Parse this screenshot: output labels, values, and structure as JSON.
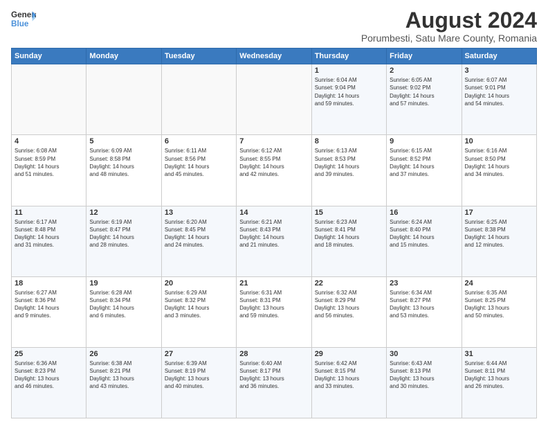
{
  "logo": {
    "line1": "General",
    "line2": "Blue"
  },
  "title": "August 2024",
  "subtitle": "Porumbesti, Satu Mare County, Romania",
  "days_of_week": [
    "Sunday",
    "Monday",
    "Tuesday",
    "Wednesday",
    "Thursday",
    "Friday",
    "Saturday"
  ],
  "weeks": [
    [
      {
        "day": "",
        "info": ""
      },
      {
        "day": "",
        "info": ""
      },
      {
        "day": "",
        "info": ""
      },
      {
        "day": "",
        "info": ""
      },
      {
        "day": "1",
        "info": "Sunrise: 6:04 AM\nSunset: 9:04 PM\nDaylight: 14 hours\nand 59 minutes."
      },
      {
        "day": "2",
        "info": "Sunrise: 6:05 AM\nSunset: 9:02 PM\nDaylight: 14 hours\nand 57 minutes."
      },
      {
        "day": "3",
        "info": "Sunrise: 6:07 AM\nSunset: 9:01 PM\nDaylight: 14 hours\nand 54 minutes."
      }
    ],
    [
      {
        "day": "4",
        "info": "Sunrise: 6:08 AM\nSunset: 8:59 PM\nDaylight: 14 hours\nand 51 minutes."
      },
      {
        "day": "5",
        "info": "Sunrise: 6:09 AM\nSunset: 8:58 PM\nDaylight: 14 hours\nand 48 minutes."
      },
      {
        "day": "6",
        "info": "Sunrise: 6:11 AM\nSunset: 8:56 PM\nDaylight: 14 hours\nand 45 minutes."
      },
      {
        "day": "7",
        "info": "Sunrise: 6:12 AM\nSunset: 8:55 PM\nDaylight: 14 hours\nand 42 minutes."
      },
      {
        "day": "8",
        "info": "Sunrise: 6:13 AM\nSunset: 8:53 PM\nDaylight: 14 hours\nand 39 minutes."
      },
      {
        "day": "9",
        "info": "Sunrise: 6:15 AM\nSunset: 8:52 PM\nDaylight: 14 hours\nand 37 minutes."
      },
      {
        "day": "10",
        "info": "Sunrise: 6:16 AM\nSunset: 8:50 PM\nDaylight: 14 hours\nand 34 minutes."
      }
    ],
    [
      {
        "day": "11",
        "info": "Sunrise: 6:17 AM\nSunset: 8:48 PM\nDaylight: 14 hours\nand 31 minutes."
      },
      {
        "day": "12",
        "info": "Sunrise: 6:19 AM\nSunset: 8:47 PM\nDaylight: 14 hours\nand 28 minutes."
      },
      {
        "day": "13",
        "info": "Sunrise: 6:20 AM\nSunset: 8:45 PM\nDaylight: 14 hours\nand 24 minutes."
      },
      {
        "day": "14",
        "info": "Sunrise: 6:21 AM\nSunset: 8:43 PM\nDaylight: 14 hours\nand 21 minutes."
      },
      {
        "day": "15",
        "info": "Sunrise: 6:23 AM\nSunset: 8:41 PM\nDaylight: 14 hours\nand 18 minutes."
      },
      {
        "day": "16",
        "info": "Sunrise: 6:24 AM\nSunset: 8:40 PM\nDaylight: 14 hours\nand 15 minutes."
      },
      {
        "day": "17",
        "info": "Sunrise: 6:25 AM\nSunset: 8:38 PM\nDaylight: 14 hours\nand 12 minutes."
      }
    ],
    [
      {
        "day": "18",
        "info": "Sunrise: 6:27 AM\nSunset: 8:36 PM\nDaylight: 14 hours\nand 9 minutes."
      },
      {
        "day": "19",
        "info": "Sunrise: 6:28 AM\nSunset: 8:34 PM\nDaylight: 14 hours\nand 6 minutes."
      },
      {
        "day": "20",
        "info": "Sunrise: 6:29 AM\nSunset: 8:32 PM\nDaylight: 14 hours\nand 3 minutes."
      },
      {
        "day": "21",
        "info": "Sunrise: 6:31 AM\nSunset: 8:31 PM\nDaylight: 13 hours\nand 59 minutes."
      },
      {
        "day": "22",
        "info": "Sunrise: 6:32 AM\nSunset: 8:29 PM\nDaylight: 13 hours\nand 56 minutes."
      },
      {
        "day": "23",
        "info": "Sunrise: 6:34 AM\nSunset: 8:27 PM\nDaylight: 13 hours\nand 53 minutes."
      },
      {
        "day": "24",
        "info": "Sunrise: 6:35 AM\nSunset: 8:25 PM\nDaylight: 13 hours\nand 50 minutes."
      }
    ],
    [
      {
        "day": "25",
        "info": "Sunrise: 6:36 AM\nSunset: 8:23 PM\nDaylight: 13 hours\nand 46 minutes."
      },
      {
        "day": "26",
        "info": "Sunrise: 6:38 AM\nSunset: 8:21 PM\nDaylight: 13 hours\nand 43 minutes."
      },
      {
        "day": "27",
        "info": "Sunrise: 6:39 AM\nSunset: 8:19 PM\nDaylight: 13 hours\nand 40 minutes."
      },
      {
        "day": "28",
        "info": "Sunrise: 6:40 AM\nSunset: 8:17 PM\nDaylight: 13 hours\nand 36 minutes."
      },
      {
        "day": "29",
        "info": "Sunrise: 6:42 AM\nSunset: 8:15 PM\nDaylight: 13 hours\nand 33 minutes."
      },
      {
        "day": "30",
        "info": "Sunrise: 6:43 AM\nSunset: 8:13 PM\nDaylight: 13 hours\nand 30 minutes."
      },
      {
        "day": "31",
        "info": "Sunrise: 6:44 AM\nSunset: 8:11 PM\nDaylight: 13 hours\nand 26 minutes."
      }
    ]
  ]
}
